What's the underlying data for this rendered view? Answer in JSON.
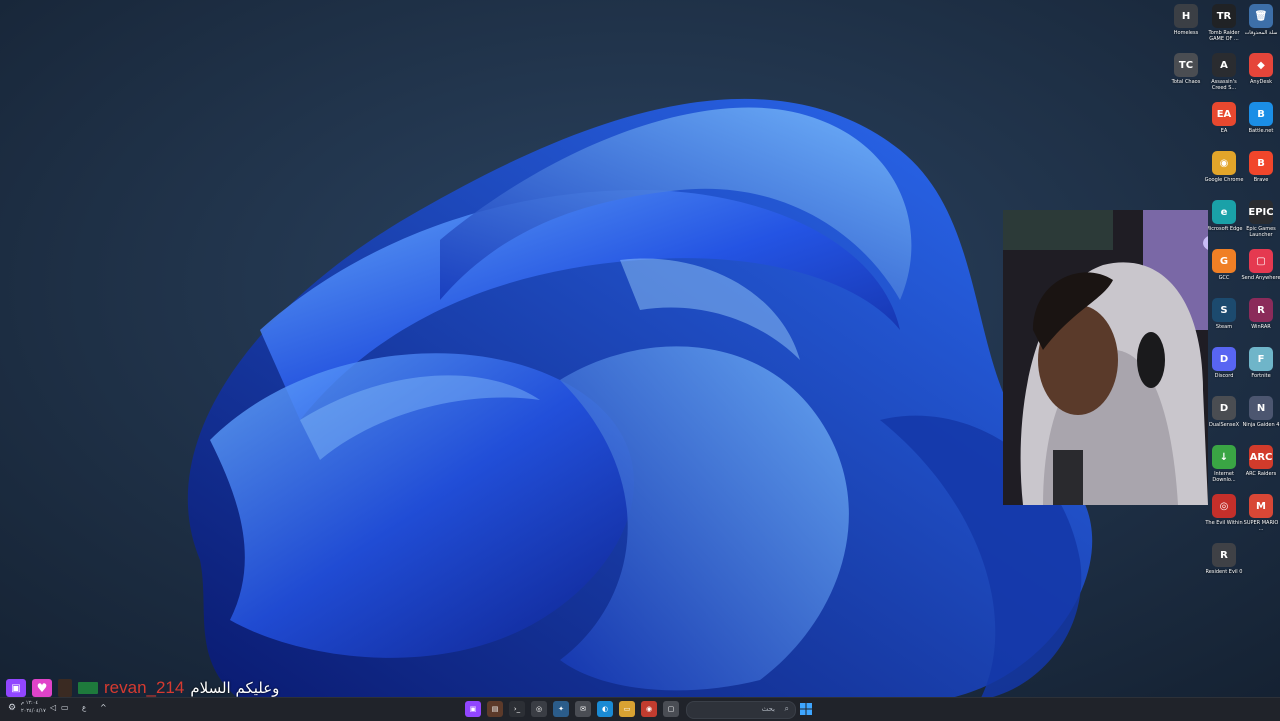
{
  "desktop": {
    "icons": [
      {
        "label": "Homeless",
        "glyph": "H",
        "color": "#3b3f45"
      },
      {
        "label": "Tomb Raider GAME OF ...",
        "glyph": "TR",
        "color": "#202225"
      },
      {
        "label": "سلة المحذوفات",
        "glyph": "🗑",
        "color": "#3d6fa8"
      },
      {
        "label": "Total Chaos",
        "glyph": "TC",
        "color": "#4a4d52"
      },
      {
        "label": "Assassin's Creed S...",
        "glyph": "A",
        "color": "#2a2c30"
      },
      {
        "label": "AnyDesk",
        "glyph": "◆",
        "color": "#e5453a"
      },
      {
        "label": "EA",
        "glyph": "EA",
        "color": "#e8482f"
      },
      {
        "label": "Battle.net",
        "glyph": "B",
        "color": "#1b8ee6"
      },
      {
        "label": "Google Chrome",
        "glyph": "◉",
        "color": "#e2a52a"
      },
      {
        "label": "Brave",
        "glyph": "B",
        "color": "#f1462b"
      },
      {
        "label": "Microsoft Edge",
        "glyph": "e",
        "color": "#1aa1a8"
      },
      {
        "label": "Epic Games Launcher",
        "glyph": "EPIC",
        "color": "#2a2c30"
      },
      {
        "label": "GCC",
        "glyph": "G",
        "color": "#f07f25"
      },
      {
        "label": "Send Anywhere",
        "glyph": "▢",
        "color": "#e53950"
      },
      {
        "label": "Steam",
        "glyph": "S",
        "color": "#1c4a6e"
      },
      {
        "label": "WinRAR",
        "glyph": "R",
        "color": "#8b2b5a"
      },
      {
        "label": "Discord",
        "glyph": "D",
        "color": "#5865f2"
      },
      {
        "label": "Fortnite",
        "glyph": "F",
        "color": "#6fb5c9"
      },
      {
        "label": "DualSenseX",
        "glyph": "D",
        "color": "#4a4d52"
      },
      {
        "label": "Ninja Gaiden 4",
        "glyph": "N",
        "color": "#4c5670"
      },
      {
        "label": "Internet Downlo...",
        "glyph": "↓",
        "color": "#3aa544"
      },
      {
        "label": "ARC Raiders",
        "glyph": "ARC",
        "color": "#d23b2b"
      },
      {
        "label": "The Evil Within",
        "glyph": "◎",
        "color": "#c42f2a"
      },
      {
        "label": "SUPER MARIO ...",
        "glyph": "M",
        "color": "#d84736"
      },
      {
        "label": "Resident Evil 0",
        "glyph": "R",
        "color": "#3f4146"
      }
    ]
  },
  "webcam": {
    "neon_sign": "cloud-lightning"
  },
  "chat_overlay": {
    "username": "revan_214",
    "message": "وعليكم السلام",
    "username_color": "#d63a30"
  },
  "taskbar": {
    "search_placeholder": "بحث",
    "tray_time": "١٢:٠٤ م",
    "tray_date": "٢٠٢٤/٠٤/١٧",
    "lang": "ع",
    "apps": [
      "twitch",
      "notepad",
      "terminal",
      "obs",
      "chatgpt",
      "mail",
      "store",
      "edge",
      "files",
      "chrome",
      "window"
    ]
  }
}
